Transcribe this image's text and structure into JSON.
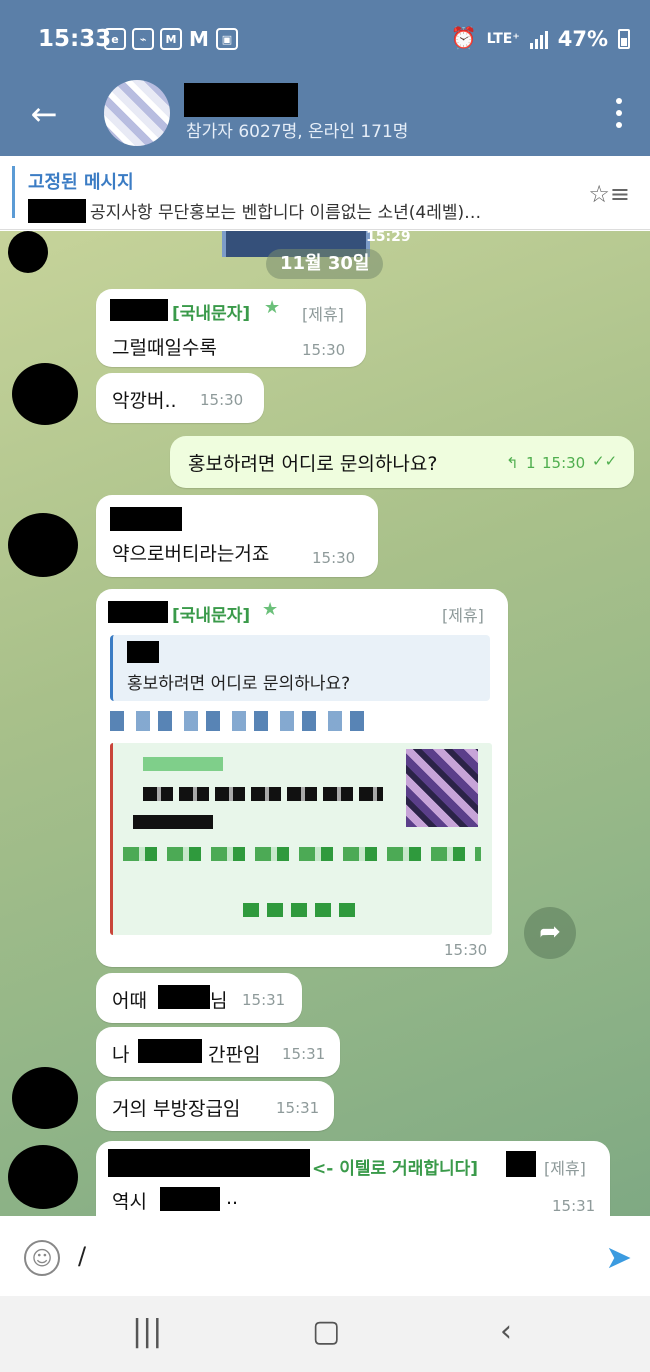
{
  "status": {
    "time": "15:33",
    "network": "LTE⁺",
    "battery": "47%",
    "icons": [
      "emart-icon",
      "nfc-icon",
      "gmail-icon",
      "mail-icon",
      "image-icon",
      "alarm-icon"
    ]
  },
  "header": {
    "subtitle": "참가자 6027명, 온라인 171명"
  },
  "pinned": {
    "title": "고정된 메시지",
    "text": "공지사항   무단홍보는 벤합니다  이름없는 소년(4레벨)…"
  },
  "chat": {
    "prev_time": "15:29",
    "date": "11월 30일",
    "messages": [
      {
        "sender_tag": "[국내문자]",
        "badge": "[제휴]",
        "text": "그럴때일수록",
        "time": "15:30"
      },
      {
        "text": "악깡버..",
        "time": "15:30"
      },
      {
        "text": "홍보하려면 어디로 문의하나요?",
        "time": "15:30",
        "replies": "1",
        "outgoing": true
      },
      {
        "text": "약으로버티라는거죠",
        "time": "15:30"
      },
      {
        "sender_tag": "[국내문자]",
        "badge": "[제휴]",
        "quote_text": "홍보하려면 어디로 문의하나요?",
        "time": "15:30"
      },
      {
        "text_a": "어때",
        "text_b": "님",
        "time": "15:31"
      },
      {
        "text_a": "나",
        "text_b": "간판임",
        "time": "15:31"
      },
      {
        "text": "거의 부방장급임",
        "time": "15:31"
      },
      {
        "sender_tag": "<- 이텔로 거래합니다]",
        "badge": "[제휴]",
        "text_a": "역시",
        "text_b": "..",
        "time": "15:31"
      }
    ]
  },
  "input": {
    "value": "/"
  },
  "colors": {
    "header": "#5b7fa8",
    "sender": "#3a9a4a",
    "outgoing_bubble": "#effdde",
    "link": "#3b7cc4"
  }
}
